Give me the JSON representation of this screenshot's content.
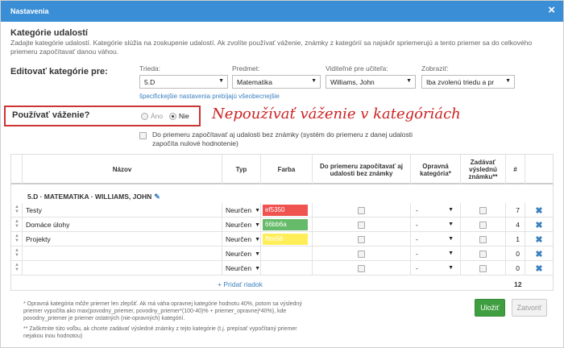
{
  "dialog": {
    "title": "Nastavenia",
    "close_icon": "×"
  },
  "section": {
    "title": "Kategórie udalostí",
    "description": "Zadajte kategórie udalostí. Kategórie slúžia na zoskupenie udalostí. Ak zvolíte používať váženie, známky z kategórií sa najskôr spriemerujú a tento priemer sa do celkového priemeru započítavať danou váhou."
  },
  "edit": {
    "label": "Editovať kategórie pre:",
    "fields": [
      {
        "label": "Trieda:",
        "value": "5.D"
      },
      {
        "label": "Predmet:",
        "value": "Matematika"
      },
      {
        "label": "Viditeľné pre učiteľa:",
        "value": "Williams, John"
      },
      {
        "label": "Zobraziť:",
        "value": "Iba zvolenú triedu a pr"
      }
    ],
    "link": "špecifickejšie nastavenia prebíjajú všeobecnejšie"
  },
  "weighting": {
    "label": "Používať váženie?",
    "options": [
      "Áno",
      "Nie"
    ],
    "selected": "Nie",
    "annotation": "Nepoužívať váženie v kategóriách"
  },
  "option": {
    "text": "Do priemeru započítavať aj udalosti bez známky (systém do priemeru z danej udalosti započíta nulové hodnotenie)"
  },
  "table": {
    "headers": {
      "name": "Názov",
      "type": "Typ",
      "color": "Farba",
      "include": "Do priemeru započítavať aj udalosti bez známky",
      "corrective": "Opravná kategória*",
      "final": "Zadávať výslednú známku**",
      "count": "#"
    },
    "group": "5.D · MATEMATIKA · WILLIAMS, JOHN",
    "rows": [
      {
        "name": "Testy",
        "type": "Neurčen",
        "color": "ef5350",
        "color_hex": "#ef5350",
        "corrective": "-",
        "count": "7"
      },
      {
        "name": "Domáce úlohy",
        "type": "Neurčen",
        "color": "66bb6a",
        "color_hex": "#66bb6a",
        "corrective": "-",
        "count": "4"
      },
      {
        "name": "Projekty",
        "type": "Neurčen",
        "color": "ffee58",
        "color_hex": "#ffee58",
        "corrective": "-",
        "count": "1"
      },
      {
        "name": "",
        "type": "Neurčen",
        "color": "",
        "color_hex": "",
        "corrective": "-",
        "count": "0"
      },
      {
        "name": "",
        "type": "Neurčen",
        "color": "",
        "color_hex": "",
        "corrective": "-",
        "count": "0"
      }
    ],
    "add_row": "+ Pridať riadok",
    "total": "12"
  },
  "footnotes": {
    "star1": "* Opravná kategória môže priemer len zlepšiť. Ak má váha opravnej kategórie hodnotu 40%, potom sa výsledný priemer vypočíta ako max(povodny_priemer, povodny_priemer*(100-40)% + priemer_opravnej*40%), kde povodny_priemer je priemer ostatných (nie-opravných) kategórií.",
    "star2": "** Zaškrtnite túto voľbu, ak chcete zadávať výsledné známky z tejto kategórie (t.j. prepísať vypočítaný priemer nejakou inou hodnotou)"
  },
  "buttons": {
    "save": "Uložiť",
    "close": "Zatvoriť"
  }
}
